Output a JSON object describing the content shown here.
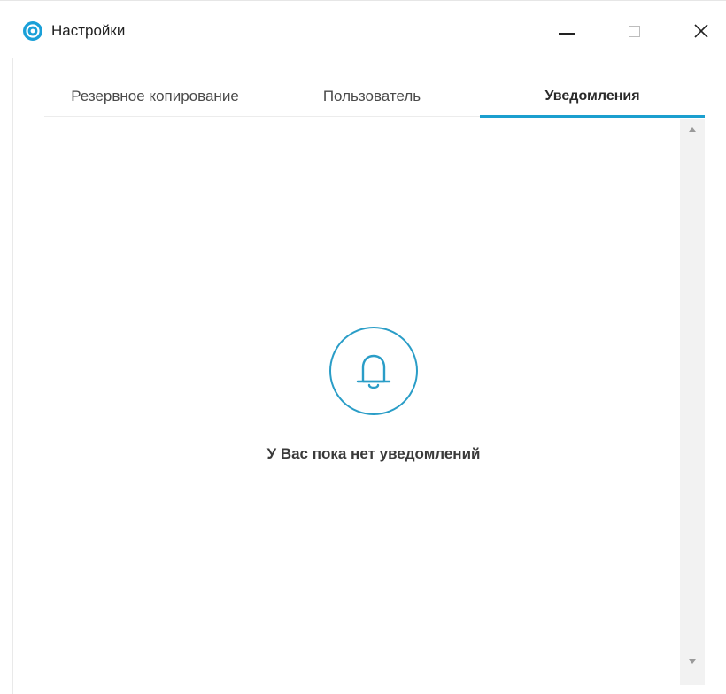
{
  "window": {
    "title": "Настройки",
    "icon": "app-logo-icon",
    "accent_color": "#1b9fcf"
  },
  "tabs": [
    {
      "label": "Резервное копирование",
      "active": false
    },
    {
      "label": "Пользователь",
      "active": false
    },
    {
      "label": "Уведомления",
      "active": true
    }
  ],
  "notifications": {
    "empty_icon": "bell-icon",
    "empty_message": "У Вас пока нет уведомлений"
  }
}
